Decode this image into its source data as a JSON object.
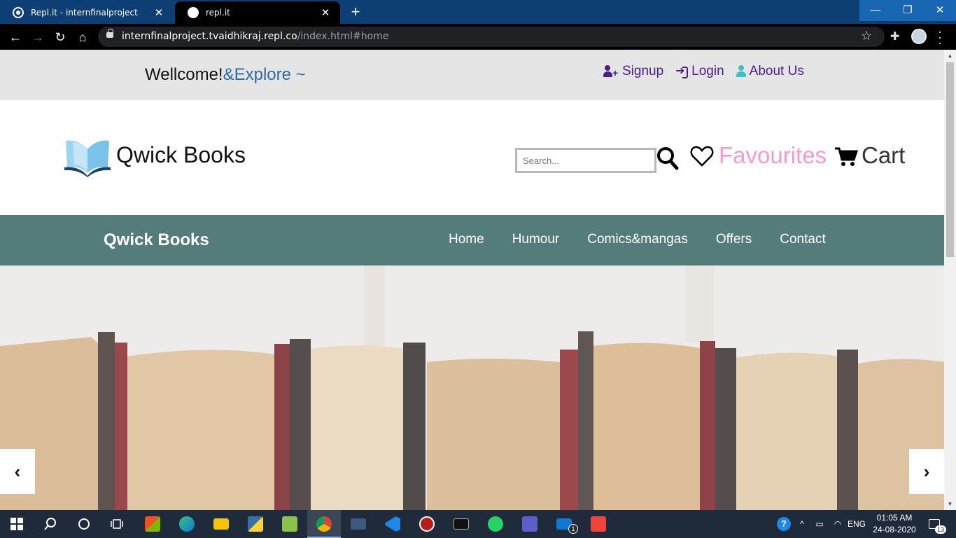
{
  "browser": {
    "tabs": [
      {
        "title": "Repl.it - internfinalproject",
        "active": false
      },
      {
        "title": "repl.it",
        "active": true
      }
    ],
    "url_main": "internfinalproject.tvaidhikraj.repl.co",
    "url_path": "/index.html#home",
    "window_controls": {
      "minimize": "—",
      "maximize": "❐",
      "close": "✕"
    }
  },
  "top_strip": {
    "welcome": "Wellcome!",
    "explore": "&Explore ~",
    "links": [
      {
        "label": "Signup",
        "icon": "user-plus-icon"
      },
      {
        "label": "Login",
        "icon": "sign-in-icon"
      },
      {
        "label": "About Us",
        "icon": "user-icon"
      }
    ]
  },
  "header": {
    "brand": "Qwick Books",
    "search_placeholder": "Search...",
    "favourites": "Favourites",
    "cart": "Cart"
  },
  "navbar": {
    "brand": "Qwick Books",
    "links": [
      "Home",
      "Humour",
      "Comics&mangas",
      "Offers",
      "Contact"
    ]
  },
  "hero": {
    "prev": "‹",
    "next": "›"
  },
  "taskbar": {
    "apps": [
      {
        "name": "start",
        "icon": "windows-icon"
      },
      {
        "name": "search",
        "icon": "search-icon"
      },
      {
        "name": "cortana",
        "icon": "cortana-icon"
      },
      {
        "name": "task-view",
        "icon": "task-view-icon"
      },
      {
        "name": "store",
        "icon": "store-icon"
      },
      {
        "name": "edge",
        "icon": "edge-icon"
      },
      {
        "name": "file-explorer",
        "icon": "folder-icon"
      },
      {
        "name": "python",
        "icon": "python-icon"
      },
      {
        "name": "notepad",
        "icon": "notepad-icon"
      },
      {
        "name": "chrome",
        "icon": "chrome-icon"
      },
      {
        "name": "sql",
        "icon": "sql-icon"
      },
      {
        "name": "vscode",
        "icon": "vscode-icon"
      },
      {
        "name": "app-spider",
        "icon": "spider-icon"
      },
      {
        "name": "terminal",
        "icon": "terminal-icon"
      },
      {
        "name": "whatsapp",
        "icon": "whatsapp-icon"
      },
      {
        "name": "teams",
        "icon": "teams-icon"
      },
      {
        "name": "mail",
        "icon": "mail-icon"
      },
      {
        "name": "anydesk",
        "icon": "anydesk-icon"
      }
    ],
    "mail_badge": "1",
    "language": "ENG",
    "time": "01:05 AM",
    "date": "24-08-2020",
    "notifications": "13"
  }
}
